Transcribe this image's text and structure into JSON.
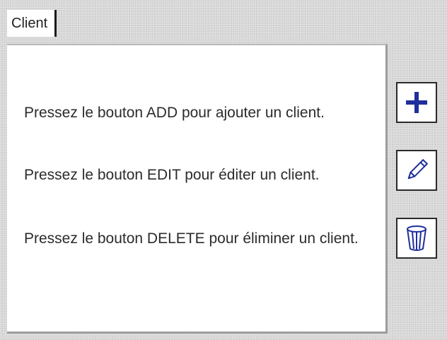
{
  "tab": {
    "label": "Client"
  },
  "panel": {
    "messages": [
      "Pressez le bouton ADD pour ajouter un client.",
      "Pressez le bouton EDIT pour éditer un client.",
      "Pressez le bouton DELETE pour éliminer un client."
    ]
  },
  "buttons": {
    "add": {
      "icon": "plus-icon",
      "color": "#1f2f9c"
    },
    "edit": {
      "icon": "pencil-icon",
      "color": "#1f2f9c"
    },
    "delete": {
      "icon": "trash-bin-icon",
      "color": "#1f2f9c"
    }
  }
}
